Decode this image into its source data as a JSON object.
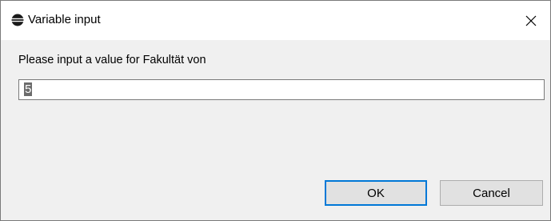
{
  "window": {
    "title": "Variable input",
    "title_icon": "eclipse-icon",
    "close_icon": "close-icon"
  },
  "dialog": {
    "prompt": "Please input a value for Fakultät von",
    "input_value": "5"
  },
  "buttons": {
    "ok_label": "OK",
    "cancel_label": "Cancel"
  },
  "colors": {
    "window_background": "#f0f0f0",
    "titlebar_background": "#ffffff",
    "default_button_border": "#0078d7",
    "button_background": "#e1e1e1",
    "selection_background": "#6b6b6b"
  }
}
